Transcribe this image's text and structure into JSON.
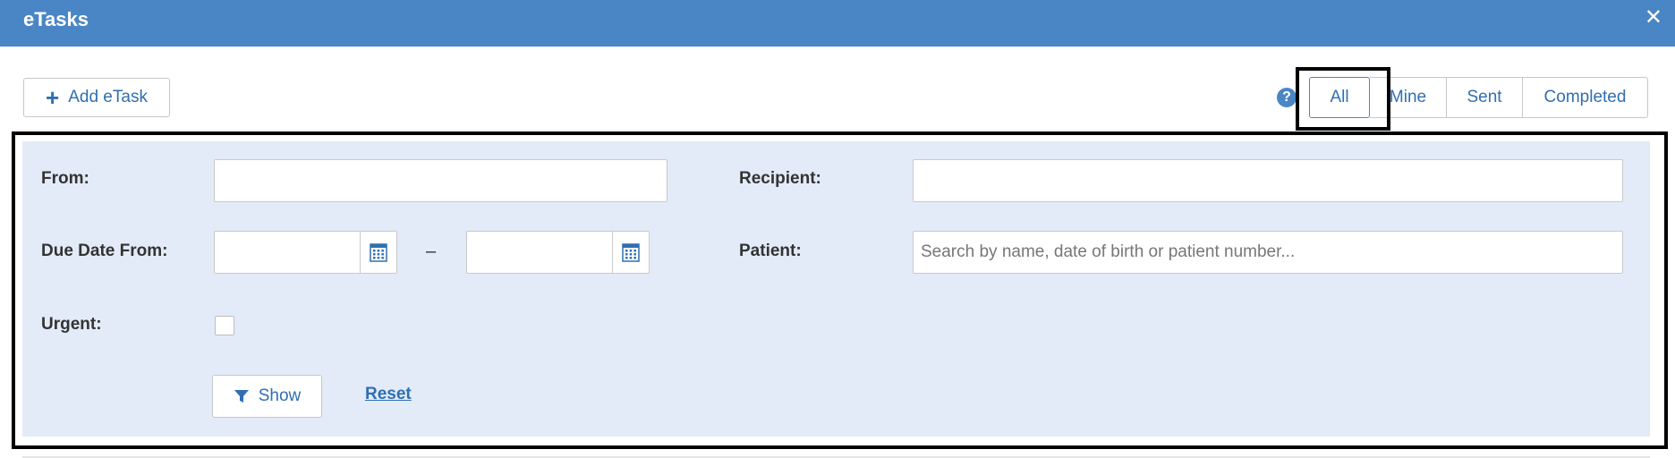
{
  "window": {
    "title": "eTasks",
    "close_glyph": "✕"
  },
  "toolbar": {
    "add_label": "Add eTask",
    "add_icon": "plus-icon",
    "help_icon": "question-circle-icon",
    "help_glyph": "?",
    "tabs": [
      {
        "label": "All",
        "active": true
      },
      {
        "label": "Mine",
        "active": false
      },
      {
        "label": "Sent",
        "active": false
      },
      {
        "label": "Completed",
        "active": false
      }
    ]
  },
  "filters": {
    "from_label": "From:",
    "from_value": "",
    "recipient_label": "Recipient:",
    "recipient_value": "",
    "due_date_label": "Due Date From:",
    "due_date_from": "",
    "due_date_to": "",
    "range_separator": "–",
    "patient_label": "Patient:",
    "patient_placeholder": "Search by name, date of birth or patient number...",
    "urgent_label": "Urgent:",
    "urgent_checked": false,
    "show_label": "Show",
    "reset_label": "Reset"
  },
  "colors": {
    "header_bg": "#4a86c5",
    "panel_bg": "#e3ebf8",
    "accent": "#2f6fb2"
  }
}
